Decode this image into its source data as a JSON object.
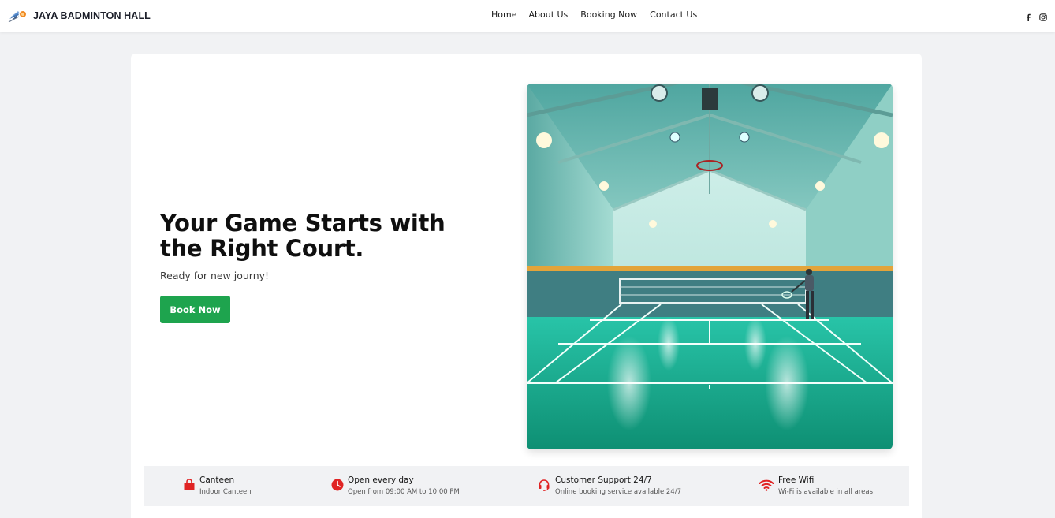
{
  "brand": {
    "name": "JAYA BADMINTON HALL",
    "logo_icon": "shuttlecock-logo-icon"
  },
  "nav": {
    "home": "Home",
    "about": "About Us",
    "booking": "Booking Now",
    "contact": "Contact Us"
  },
  "socials": {
    "facebook_icon": "facebook-icon",
    "instagram_icon": "instagram-icon"
  },
  "hero": {
    "title": "Your Game Starts with the Right Court.",
    "subtitle": "Ready for new journy!",
    "button": "Book Now",
    "image": "indoor-badminton-court-photo"
  },
  "features": [
    {
      "icon": "shopping-bag-icon",
      "title": "Canteen",
      "desc": "Indoor Canteen"
    },
    {
      "icon": "clock-icon",
      "title": "Open every day",
      "desc": "Open from 09:00 AM to 10:00 PM"
    },
    {
      "icon": "headset-icon",
      "title": "Customer Support 24/7",
      "desc": "Online booking service available 24/7"
    },
    {
      "icon": "wifi-icon",
      "title": "Free Wifi",
      "desc": "Wi-Fi is available in all areas"
    }
  ],
  "colors": {
    "accent_green": "#1ea44e",
    "icon_red": "#e02424",
    "page_bg": "#f1f2f4",
    "court_green": "#1fb39a"
  }
}
